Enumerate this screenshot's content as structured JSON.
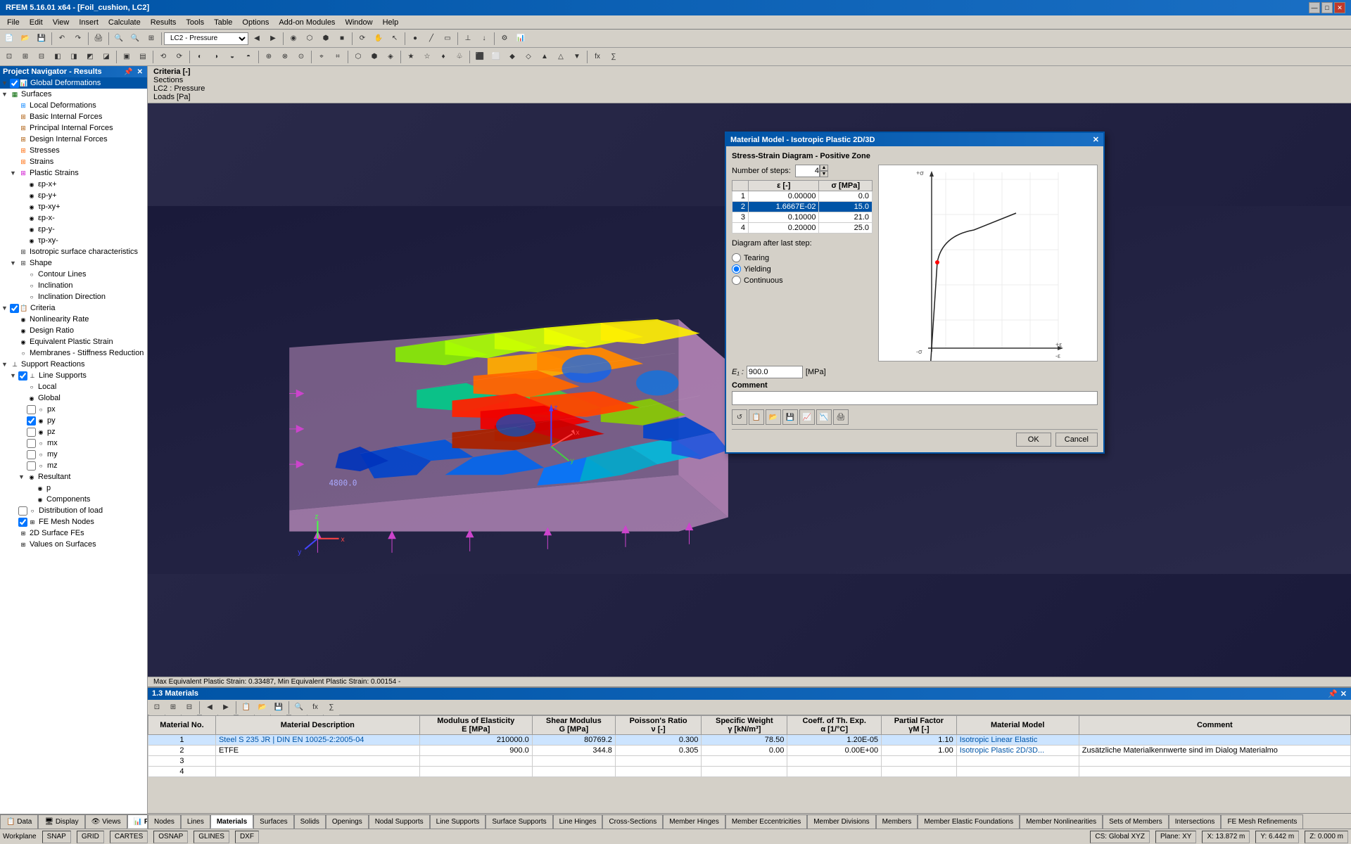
{
  "window": {
    "title": "RFEM 5.16.01 x64 - [Foil_cushion, LC2]",
    "minimize": "—",
    "maximize": "□",
    "close": "✕"
  },
  "menu": {
    "items": [
      "File",
      "Edit",
      "View",
      "Insert",
      "Calculate",
      "Results",
      "Tools",
      "Table",
      "Options",
      "Add-on Modules",
      "Window",
      "Help"
    ]
  },
  "navigator": {
    "title": "Project Navigator - Results",
    "items": [
      {
        "id": "global-def",
        "label": "Global Deformations",
        "level": 1,
        "selected": true,
        "hasCheck": true,
        "checked": true
      },
      {
        "id": "surfaces",
        "label": "Surfaces",
        "level": 1,
        "selected": false,
        "hasExpand": true
      },
      {
        "id": "local-def",
        "label": "Local Deformations",
        "level": 2
      },
      {
        "id": "basic-forces",
        "label": "Basic Internal Forces",
        "level": 2
      },
      {
        "id": "principal-forces",
        "label": "Principal Internal Forces",
        "level": 2
      },
      {
        "id": "design-forces",
        "label": "Design Internal Forces",
        "level": 2
      },
      {
        "id": "stresses",
        "label": "Stresses",
        "level": 2
      },
      {
        "id": "strains",
        "label": "Strains",
        "level": 2
      },
      {
        "id": "plastic-strains",
        "label": "Plastic Strains",
        "level": 2,
        "hasExpand": true
      },
      {
        "id": "ep-xp",
        "label": "εp-x+",
        "level": 3
      },
      {
        "id": "ep-yp",
        "label": "εp-y+",
        "level": 3
      },
      {
        "id": "tp-xyp",
        "label": "τp-xy+",
        "level": 3
      },
      {
        "id": "ep-xm",
        "label": "εp-x-",
        "level": 3
      },
      {
        "id": "ep-ym",
        "label": "εp-y-",
        "level": 3
      },
      {
        "id": "tp-xym",
        "label": "τp-xy-",
        "level": 3
      },
      {
        "id": "isotropic-char",
        "label": "Isotropic surface characteristics",
        "level": 2
      },
      {
        "id": "shape",
        "label": "Shape",
        "level": 2,
        "hasExpand": true
      },
      {
        "id": "contour-lines",
        "label": "Contour Lines",
        "level": 3
      },
      {
        "id": "inclination",
        "label": "Inclination",
        "level": 3
      },
      {
        "id": "inclination-dir",
        "label": "Inclination Direction",
        "level": 3
      },
      {
        "id": "criteria",
        "label": "Criteria",
        "level": 1,
        "hasCheck": true,
        "checked": true
      },
      {
        "id": "nonlinearity-rate",
        "label": "Nonlinearity Rate",
        "level": 2
      },
      {
        "id": "design-ratio",
        "label": "Design Ratio",
        "level": 2
      },
      {
        "id": "equivalent-plastic",
        "label": "Equivalent Plastic Strain",
        "level": 2
      },
      {
        "id": "membranes-stiff",
        "label": "Membranes - Stiffness Reduction",
        "level": 2
      },
      {
        "id": "support-reactions",
        "label": "Support Reactions",
        "level": 1,
        "hasExpand": true
      },
      {
        "id": "line-supports",
        "label": "Line Supports",
        "level": 2,
        "hasExpand": true
      },
      {
        "id": "local",
        "label": "Local",
        "level": 3
      },
      {
        "id": "global",
        "label": "Global",
        "level": 3
      },
      {
        "id": "px",
        "label": "px",
        "level": 3,
        "hasCheck": true
      },
      {
        "id": "py",
        "label": "py",
        "level": 3,
        "hasCheck": true,
        "checked": true
      },
      {
        "id": "pz",
        "label": "pz",
        "level": 3,
        "hasCheck": true
      },
      {
        "id": "mx",
        "label": "mx",
        "level": 3,
        "hasCheck": true
      },
      {
        "id": "my",
        "label": "my",
        "level": 3,
        "hasCheck": true
      },
      {
        "id": "mz",
        "label": "mz",
        "level": 3,
        "hasCheck": true
      },
      {
        "id": "resultant",
        "label": "Resultant",
        "level": 3,
        "hasExpand": true
      },
      {
        "id": "p-res",
        "label": "p",
        "level": 4
      },
      {
        "id": "components",
        "label": "Components",
        "level": 4
      },
      {
        "id": "dist-load",
        "label": "Distribution of load",
        "level": 2
      },
      {
        "id": "fe-mesh-nodes",
        "label": "FE Mesh Nodes",
        "level": 2,
        "hasCheck": true,
        "checked": true
      },
      {
        "id": "2d-surface",
        "label": "2D Surface FEs",
        "level": 2
      },
      {
        "id": "values-on",
        "label": "Values on Surfaces",
        "level": 2
      }
    ]
  },
  "criteria": {
    "label": "Criteria [-]",
    "sections": "Sections",
    "lc2": "LC2 : Pressure",
    "loads": "Loads [Pa]"
  },
  "model3d": {
    "status_text": "Max Equivalent Plastic Strain: 0.33487, Min Equivalent Plastic Strain: 0.00154 -",
    "coord_label": "4800.0"
  },
  "dialog": {
    "title": "Material Model - Isotropic Plastic 2D/3D",
    "section_title": "Stress-Strain Diagram - Positive Zone",
    "steps_label": "Number of steps:",
    "steps_value": "4",
    "diagram_label": "Diagram after last step:",
    "radio_tearing": "Tearing",
    "radio_yielding": "Yielding",
    "radio_continuous": "Continuous",
    "table_headers": [
      "",
      "ε [-]",
      "σ [MPa]"
    ],
    "table_rows": [
      {
        "row": "1",
        "epsilon": "0.00000",
        "sigma": "0.0"
      },
      {
        "row": "2",
        "epsilon": "1.6667E-02",
        "sigma": "15.0"
      },
      {
        "row": "3",
        "epsilon": "0.10000",
        "sigma": "21.0"
      },
      {
        "row": "4",
        "epsilon": "0.20000",
        "sigma": "25.0"
      }
    ],
    "e1_label": "E₁ :",
    "e1_value": "900.0",
    "e1_unit": "[MPa]",
    "comment_label": "Comment",
    "comment_value": "",
    "ok_label": "OK",
    "cancel_label": "Cancel"
  },
  "toolbar_combo": {
    "value": "LC2 - Pressure",
    "placeholder": "LC2 - Pressure"
  },
  "materials_table": {
    "title": "1.3 Materials",
    "headers": [
      "Material No.",
      "Material Description",
      "Modulus of Elasticity E [MPa]",
      "Shear Modulus G [MPa]",
      "Poisson's Ratio ν [-]",
      "Specific Weight γ [kN/m³]",
      "Coeff. of Th. Exp. α [1/°C]",
      "Partial Factor γM [-]",
      "Material Model",
      "Comment"
    ],
    "rows": [
      {
        "no": "1",
        "desc": "Steel S 235 JR | DIN EN 10025-2:2005-04",
        "E": "210000.0",
        "G": "80769.2",
        "nu": "0.300",
        "gamma": "78.50",
        "alpha": "1.20E-05",
        "partial": "1.10",
        "model": "Isotropic Linear Elastic",
        "comment": ""
      },
      {
        "no": "2",
        "desc": "ETFE",
        "E": "900.0",
        "G": "344.8",
        "nu": "0.305",
        "gamma": "0.00",
        "alpha": "0.00E+00",
        "partial": "1.00",
        "model": "Isotropic Plastic 2D/3D...",
        "comment": "Zusätzliche Materialkennwerte sind im Dialog Materialmo"
      },
      {
        "no": "3",
        "desc": "",
        "E": "",
        "G": "",
        "nu": "",
        "gamma": "",
        "alpha": "",
        "partial": "",
        "model": "",
        "comment": ""
      },
      {
        "no": "4",
        "desc": "",
        "E": "",
        "G": "",
        "nu": "",
        "gamma": "",
        "alpha": "",
        "partial": "",
        "model": "",
        "comment": ""
      }
    ]
  },
  "bottom_tabs": [
    "Nodes",
    "Lines",
    "Materials",
    "Surfaces",
    "Solids",
    "Openings",
    "Nodal Supports",
    "Line Supports",
    "Surface Supports",
    "Line Hinges",
    "Cross-Sections",
    "Member Hinges",
    "Member Eccentricities",
    "Member Divisions",
    "Members",
    "Member Elastic Foundations",
    "Member Nonlinearities",
    "Sets of Members",
    "Intersections",
    "FE Mesh Refinements"
  ],
  "view_tabs": [
    "Data",
    "Display",
    "Views",
    "Results"
  ],
  "status_bar": {
    "workplane": "Workplane",
    "snap": "SNAP",
    "grid": "GRID",
    "cartes": "CARTES",
    "osnap": "OSNAP",
    "glines": "GLINES",
    "dxf": "DXF",
    "cs": "CS: Global XYZ",
    "plane": "Plane: XY",
    "x": "X: 13.872 m",
    "y": "Y: 6.442 m",
    "z": "Z: 0.000 m"
  }
}
